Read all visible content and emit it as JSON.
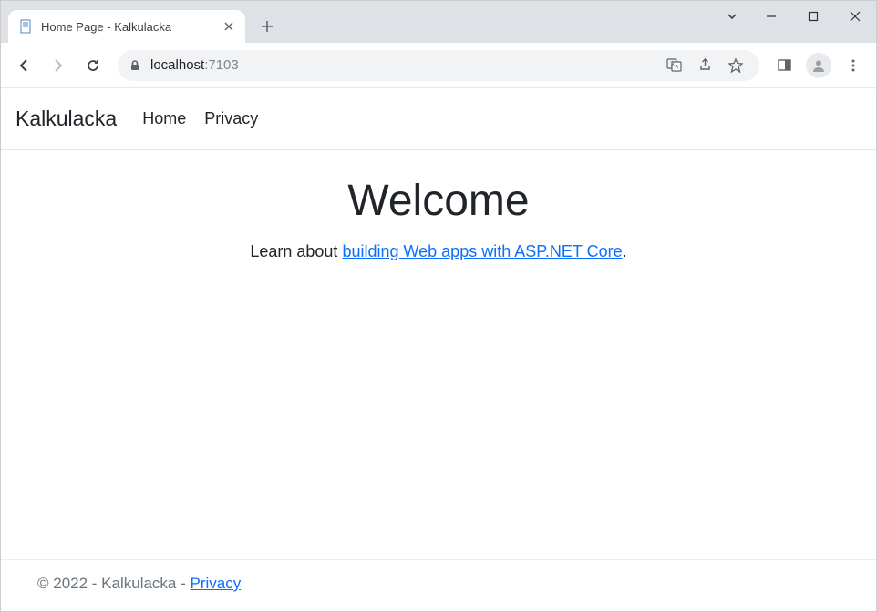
{
  "browser": {
    "tab_title": "Home Page - Kalkulacka",
    "url_host": "localhost",
    "url_port": ":7103"
  },
  "nav": {
    "brand": "Kalkulacka",
    "links": [
      "Home",
      "Privacy"
    ]
  },
  "main": {
    "title": "Welcome",
    "learn_prefix": "Learn about ",
    "learn_link": "building Web apps with ASP.NET Core",
    "learn_suffix": "."
  },
  "footer": {
    "text": "© 2022 - Kalkulacka - ",
    "link": "Privacy"
  }
}
